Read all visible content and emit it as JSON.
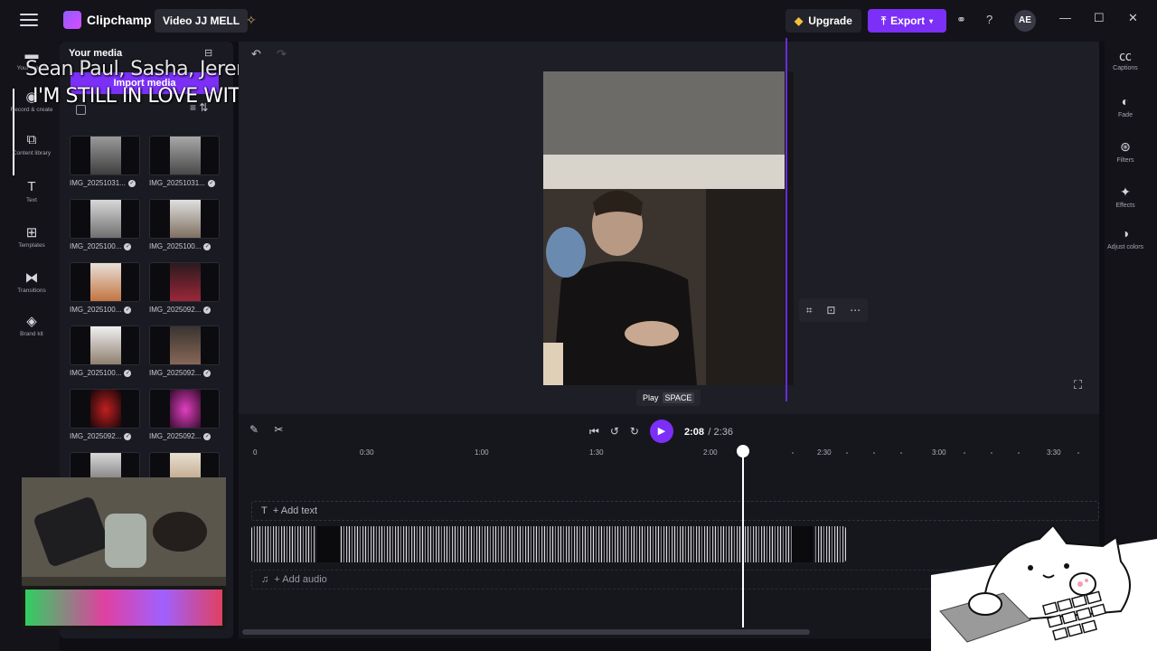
{
  "topbar": {
    "app_name": "Clipchamp",
    "project_name": "Video JJ MELL",
    "upgrade_label": "Upgrade",
    "export_label": "Export",
    "avatar_initials": "AE"
  },
  "left_rail": {
    "items": [
      {
        "label": "Your media",
        "icon": "folder-icon"
      },
      {
        "label": "Record & create",
        "icon": "record-icon"
      },
      {
        "label": "Content library",
        "icon": "library-icon"
      },
      {
        "label": "Text",
        "icon": "text-icon"
      },
      {
        "label": "Templates",
        "icon": "templates-icon"
      },
      {
        "label": "Transitions",
        "icon": "transitions-icon"
      },
      {
        "label": "Brand kit",
        "icon": "brand-kit-icon"
      }
    ]
  },
  "media_panel": {
    "title": "Your media",
    "import_label": "Import media",
    "items": [
      {
        "name": "IMG_20251031..."
      },
      {
        "name": "IMG_20251031..."
      },
      {
        "name": "IMG_2025100..."
      },
      {
        "name": "IMG_2025100..."
      },
      {
        "name": "IMG_2025100..."
      },
      {
        "name": "IMG_2025092..."
      },
      {
        "name": "IMG_2025100..."
      },
      {
        "name": "IMG_2025092..."
      },
      {
        "name": "IMG_2025092..."
      },
      {
        "name": "IMG_2025092..."
      },
      {
        "name": ""
      },
      {
        "name": ""
      }
    ]
  },
  "lyrics": {
    "line1": "Sean Paul, Sasha, Jeremy Har",
    "line2": "I'M STILL IN LOVE WITH YOU (F"
  },
  "preview": {
    "tooltip_label": "Play",
    "tooltip_key": "SPACE"
  },
  "right_rail": {
    "items": [
      {
        "label": "Captions",
        "icon": "captions-icon"
      },
      {
        "label": "Fade",
        "icon": "fade-icon"
      },
      {
        "label": "Filters",
        "icon": "filters-icon"
      },
      {
        "label": "Effects",
        "icon": "effects-icon"
      },
      {
        "label": "Adjust colors",
        "icon": "adjust-colors-icon"
      }
    ]
  },
  "timeline": {
    "current_time": "2:08",
    "total_time": "/ 2:36",
    "ruler_labels": [
      "0",
      "0:30",
      "1:00",
      "1:30",
      "2:00",
      "2:30",
      "3:00",
      "3:30"
    ],
    "add_text_label": "+ Add text",
    "add_audio_label": "+ Add audio"
  },
  "colors": {
    "accent": "#7b2ff7",
    "background": "#16161d"
  }
}
